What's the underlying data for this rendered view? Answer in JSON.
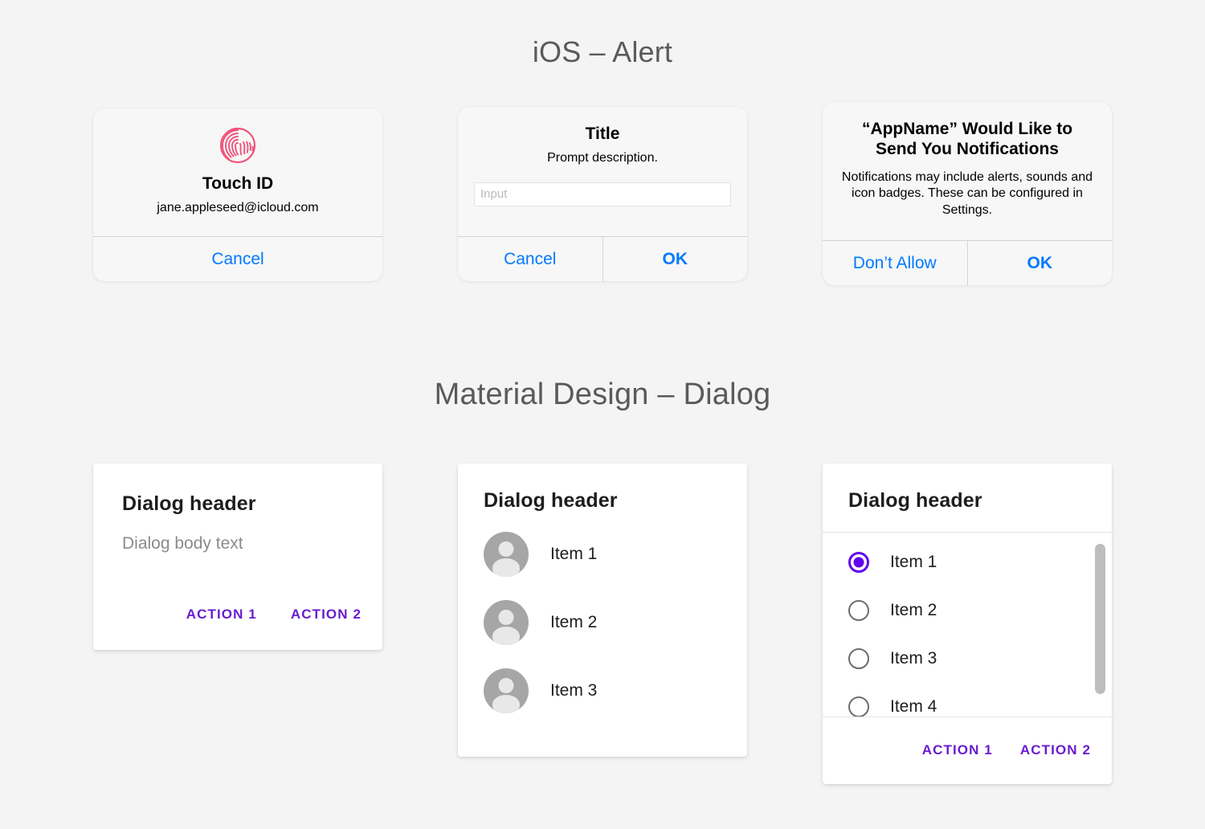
{
  "sections": {
    "ios": {
      "title": "iOS – Alert"
    },
    "material": {
      "title": "Material Design – Dialog"
    }
  },
  "colors": {
    "page_background": "#f4f4f4",
    "ios_card": "#f7f7f7",
    "ios_tint": "#007aff",
    "material_accent": "#6200ee",
    "material_action": "#6a1bd1",
    "fingerprint": "#f0547b",
    "avatar_circle": "#a6a6a6",
    "scrollbar_thumb": "#bdbdbd"
  },
  "ios_alerts": [
    {
      "id": "touch-id",
      "icon": "fingerprint-icon",
      "title": "Touch ID",
      "subtitle": "jane.appleseed@icloud.com",
      "buttons": [
        {
          "label": "Cancel",
          "style": "normal"
        }
      ]
    },
    {
      "id": "prompt",
      "title": "Title",
      "description": "Prompt description.",
      "input": {
        "value": "",
        "placeholder": "Input"
      },
      "buttons": [
        {
          "label": "Cancel",
          "style": "normal"
        },
        {
          "label": "OK",
          "style": "bold"
        }
      ]
    },
    {
      "id": "notifications",
      "title": "“AppName” Would Like to Send You Notifications",
      "description": "Notifications may include alerts, sounds and icon badges. These can be configured in Settings.",
      "buttons": [
        {
          "label": "Don’t Allow",
          "style": "normal"
        },
        {
          "label": "OK",
          "style": "bold"
        }
      ]
    }
  ],
  "material_dialogs": [
    {
      "id": "basic",
      "header": "Dialog header",
      "body": "Dialog body text",
      "actions": [
        "ACTION 1",
        "ACTION 2"
      ]
    },
    {
      "id": "list",
      "header": "Dialog header",
      "items": [
        {
          "label": "Item 1",
          "icon": "avatar-icon"
        },
        {
          "label": "Item 2",
          "icon": "avatar-icon"
        },
        {
          "label": "Item 3",
          "icon": "avatar-icon"
        }
      ]
    },
    {
      "id": "radio",
      "header": "Dialog header",
      "options": [
        {
          "label": "Item 1",
          "selected": true
        },
        {
          "label": "Item 2",
          "selected": false
        },
        {
          "label": "Item 3",
          "selected": false
        },
        {
          "label": "Item 4",
          "selected": false
        }
      ],
      "actions": [
        "ACTION 1",
        "ACTION 2"
      ],
      "scrollbar": {
        "visible": true
      }
    }
  ]
}
